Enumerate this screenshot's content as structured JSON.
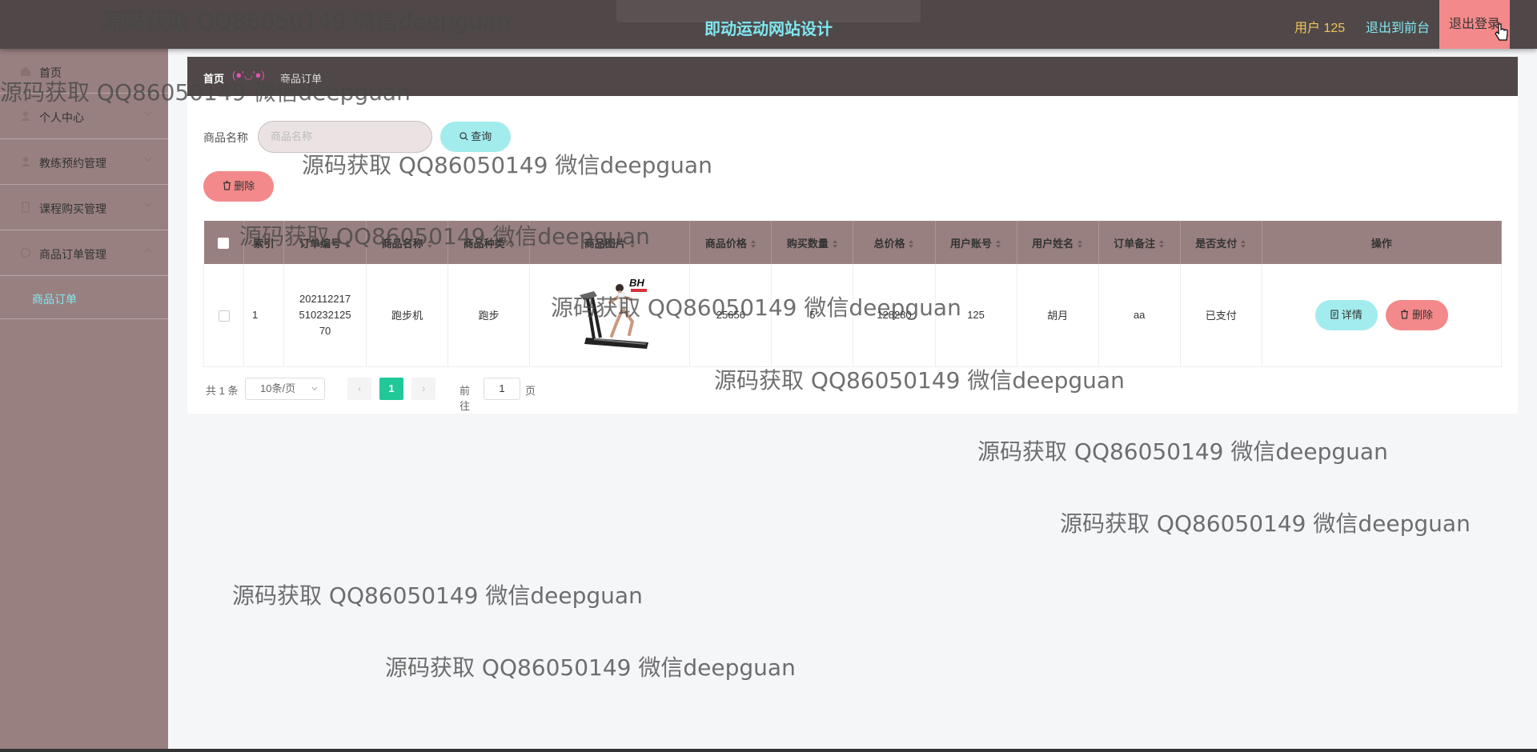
{
  "header": {
    "title": "即动运动网站设计",
    "user": "用户 125",
    "front": "退出到前台",
    "logout": "退出登录"
  },
  "sidebar": {
    "items": [
      {
        "label": "首页",
        "icon": "home-icon"
      },
      {
        "label": "个人中心",
        "icon": "user-icon"
      },
      {
        "label": "教练预约管理",
        "icon": "user-icon"
      },
      {
        "label": "课程购买管理",
        "icon": "doc-icon"
      },
      {
        "label": "商品订单管理",
        "icon": "circle-icon"
      }
    ],
    "sub": "商品订单"
  },
  "breadcrumb": {
    "home": "首页",
    "sep": "(●'◡'●)",
    "current": "商品订单"
  },
  "search": {
    "label": "商品名称",
    "placeholder": "商品名称",
    "query": "查询",
    "delete": "删除"
  },
  "table": {
    "headers": [
      "索引",
      "订单编号",
      "商品名称",
      "商品种类",
      "商品图片",
      "商品价格",
      "购买数量",
      "总价格",
      "用户账号",
      "用户姓名",
      "订单备注",
      "是否支付",
      "操作"
    ],
    "rows": [
      {
        "index": "1",
        "order_no": "20211221751023212570",
        "order_no_lines": [
          "202112217",
          "510232125",
          "70"
        ],
        "name": "跑步机",
        "kind": "跑步",
        "price": "25656",
        "qty": "5",
        "total": "128280",
        "account": "125",
        "user_name": "胡月",
        "note": "aa",
        "paid": "已支付",
        "detail": "详情",
        "delete": "删除",
        "image_brand": "BH"
      }
    ]
  },
  "pagination": {
    "total": "共 1 条",
    "size": "10条/页",
    "current": "1",
    "goto": "前往",
    "goto_value": "1",
    "page": "页"
  },
  "watermark": "源码获取 QQ86050149 微信deepguan",
  "colors": {
    "header_bg": "#504848",
    "sidebar_bg": "#998080",
    "accent_cyan": "#7fe8f0",
    "button_cyan": "#a3ecee",
    "button_pink": "#f3898a",
    "page_active": "#20c997"
  }
}
